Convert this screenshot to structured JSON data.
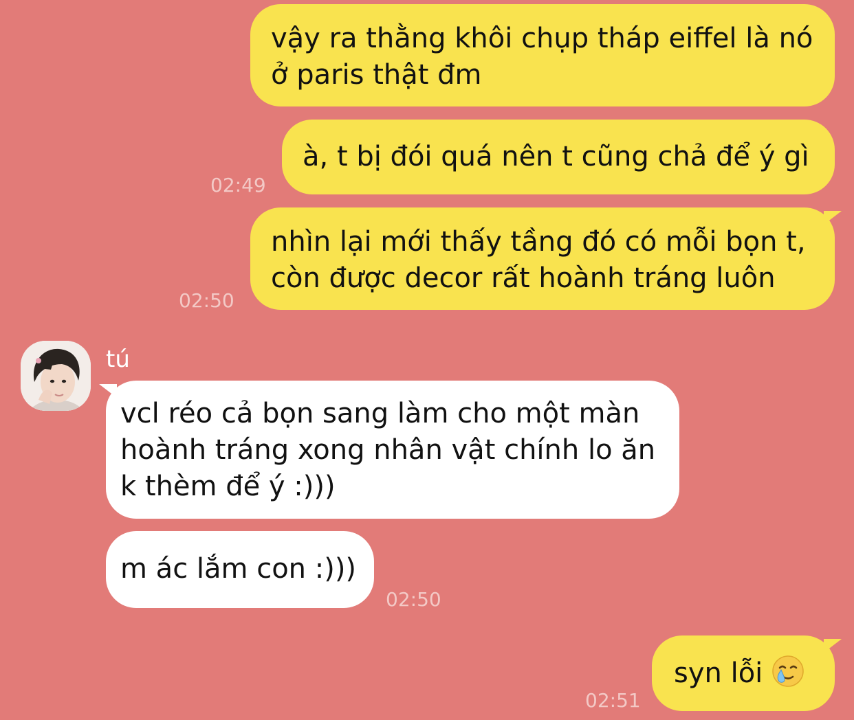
{
  "messages": [
    {
      "direction": "out",
      "lines": [
        "vậy ra thằng khôi chụp tháp eiffel là nó",
        "ở paris thật đm"
      ],
      "time": ""
    },
    {
      "direction": "out",
      "lines": [
        "à, t bị đói quá nên t cũng chả để ý gì"
      ],
      "time": "02:49"
    },
    {
      "direction": "out",
      "lines": [
        "nhìn lại mới thấy tầng đó có mỗi bọn t,",
        "còn được decor rất hoành tráng luôn"
      ],
      "time": "02:50"
    },
    {
      "direction": "in",
      "sender": "tú",
      "lines": [
        "vcl réo cả bọn sang làm cho một màn",
        "hoành tráng xong nhân vật chính lo ăn",
        "k thèm để ý :)))"
      ],
      "time": ""
    },
    {
      "direction": "in",
      "lines": [
        "m ác lắm con :)))"
      ],
      "time": "02:50"
    },
    {
      "direction": "out",
      "lines": [
        "syn lỗi"
      ],
      "emoji": "crying-smile-emoji",
      "time": "02:51"
    }
  ],
  "colors": {
    "background": "#e27b78",
    "outgoing_bubble": "#f9e34f",
    "incoming_bubble": "#ffffff",
    "timestamp": "#f3c9c6"
  }
}
